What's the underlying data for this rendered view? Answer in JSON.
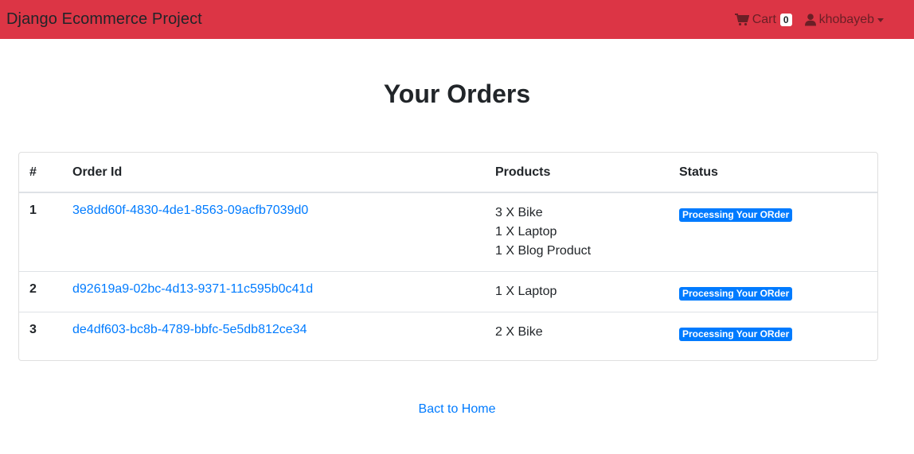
{
  "navbar": {
    "brand": "Django Ecommerce Project",
    "cart_label": "Cart",
    "cart_count": "0",
    "username": "khobayeb",
    "bg_color": "#dc3545"
  },
  "page": {
    "title": "Your Orders"
  },
  "orders_table": {
    "headers": [
      "#",
      "Order Id",
      "Products",
      "Status"
    ],
    "rows": [
      {
        "num": "1",
        "order_id": "3e8dd60f-4830-4de1-8563-09acfb7039d0",
        "products": [
          "3 X Bike",
          "1 X Laptop",
          "1 X Blog Product"
        ],
        "status": "Processing Your ORder"
      },
      {
        "num": "2",
        "order_id": "d92619a9-02bc-4d13-9371-11c595b0c41d",
        "products": [
          "1 X Laptop"
        ],
        "status": "Processing Your ORder"
      },
      {
        "num": "3",
        "order_id": "de4df603-bc8b-4789-bbfc-5e5db812ce34",
        "products": [
          "2 X Bike"
        ],
        "status": "Processing Your ORder"
      }
    ]
  },
  "footer": {
    "home_link": "Bact to Home"
  },
  "icons": {
    "cart": "shopping-cart-icon",
    "user": "user-icon"
  },
  "colors": {
    "link": "#007bff",
    "badge": "#007bff"
  }
}
